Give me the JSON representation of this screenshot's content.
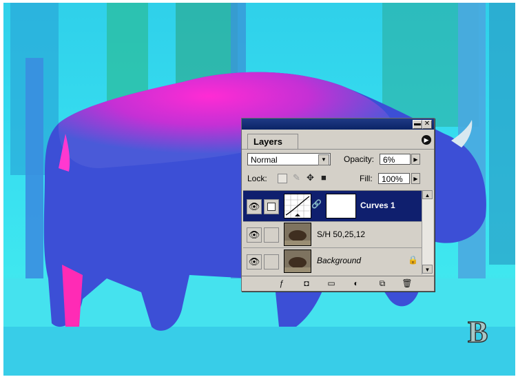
{
  "panel": {
    "tab_label": "Layers",
    "blend_mode": "Normal",
    "opacity_label": "Opacity:",
    "opacity_value": "6%",
    "lock_label": "Lock:",
    "fill_label": "Fill:",
    "fill_value": "100%",
    "layers": [
      {
        "name": "Curves 1",
        "selected": true,
        "visible": true,
        "type": "adjustment"
      },
      {
        "name": "S/H 50,25,12",
        "selected": false,
        "visible": true,
        "type": "image"
      },
      {
        "name": "Background",
        "selected": false,
        "visible": true,
        "type": "image",
        "locked": true
      }
    ],
    "titlebar_buttons": [
      "minimize-icon",
      "close-icon"
    ],
    "bottom_icons": [
      "layer-style-icon",
      "layer-mask-icon",
      "new-set-icon",
      "new-adjustment-layer-icon",
      "new-layer-icon",
      "trash-icon"
    ]
  },
  "figure_label": "B",
  "colors": {
    "panel_bg": "#d4d0c8",
    "titlebar": "#0b2466",
    "selection": "#0f1f6e",
    "photo_cyan": "#30d8f0",
    "bison_blue": "#3a52d8",
    "bison_magenta": "#e020c0"
  }
}
